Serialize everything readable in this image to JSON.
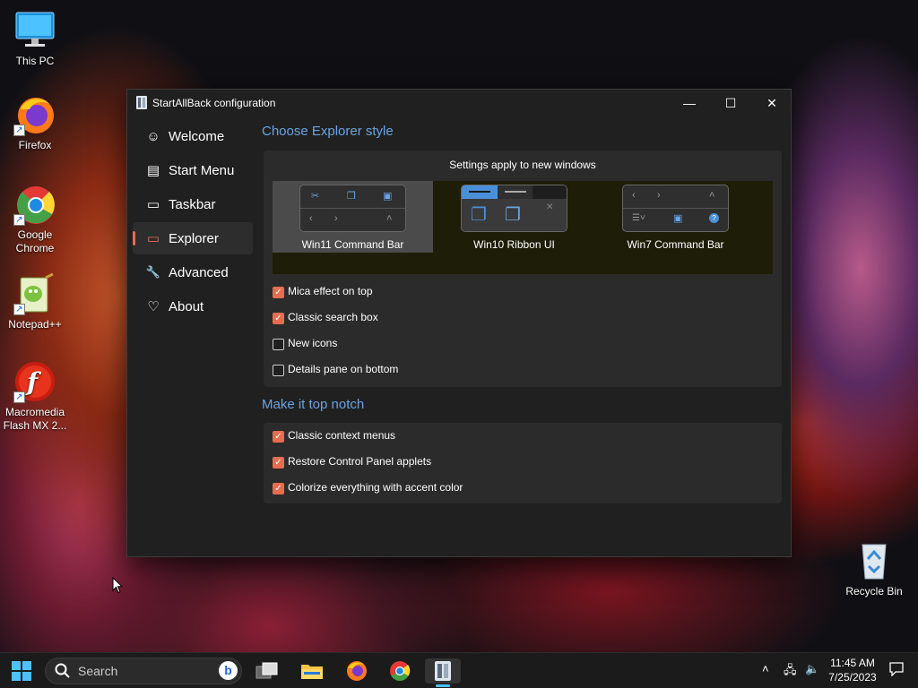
{
  "desktop": {
    "icons": [
      {
        "label": "This PC"
      },
      {
        "label": "Firefox"
      },
      {
        "label": "Google Chrome"
      },
      {
        "label": "Notepad++"
      },
      {
        "label": "Macromedia Flash MX 2..."
      },
      {
        "label": "Recycle Bin"
      }
    ]
  },
  "window": {
    "title": "StartAllBack configuration",
    "controls": {
      "minimize": "—",
      "maximize": "☐",
      "close": "✕"
    }
  },
  "sidebar": {
    "items": [
      {
        "label": "Welcome",
        "icon": "☺"
      },
      {
        "label": "Start Menu",
        "icon": "▤"
      },
      {
        "label": "Taskbar",
        "icon": "▭"
      },
      {
        "label": "Explorer",
        "icon": "▭"
      },
      {
        "label": "Advanced",
        "icon": "🔧"
      },
      {
        "label": "About",
        "icon": "♡"
      }
    ],
    "active_index": 3
  },
  "explorer_style": {
    "title": "Choose Explorer style",
    "note": "Settings apply to new windows",
    "options": [
      {
        "label": "Win11 Command Bar",
        "selected": true
      },
      {
        "label": "Win10 Ribbon UI",
        "selected": false
      },
      {
        "label": "Win7 Command Bar",
        "selected": false
      }
    ],
    "checkboxes": [
      {
        "label": "Mica effect on top",
        "checked": true
      },
      {
        "label": "Classic search box",
        "checked": true
      },
      {
        "label": "New icons",
        "checked": false
      },
      {
        "label": "Details pane on bottom",
        "checked": false
      }
    ]
  },
  "top_notch": {
    "title": "Make it top notch",
    "checkboxes": [
      {
        "label": "Classic context menus",
        "checked": true
      },
      {
        "label": "Restore Control Panel applets",
        "checked": true
      },
      {
        "label": "Colorize everything with accent color",
        "checked": true
      }
    ]
  },
  "taskbar": {
    "search_placeholder": "Search",
    "clock_time": "11:45 AM",
    "clock_date": "7/25/2023"
  },
  "colors": {
    "accent": "#e86c4f",
    "section_title": "#6aa4e0"
  }
}
